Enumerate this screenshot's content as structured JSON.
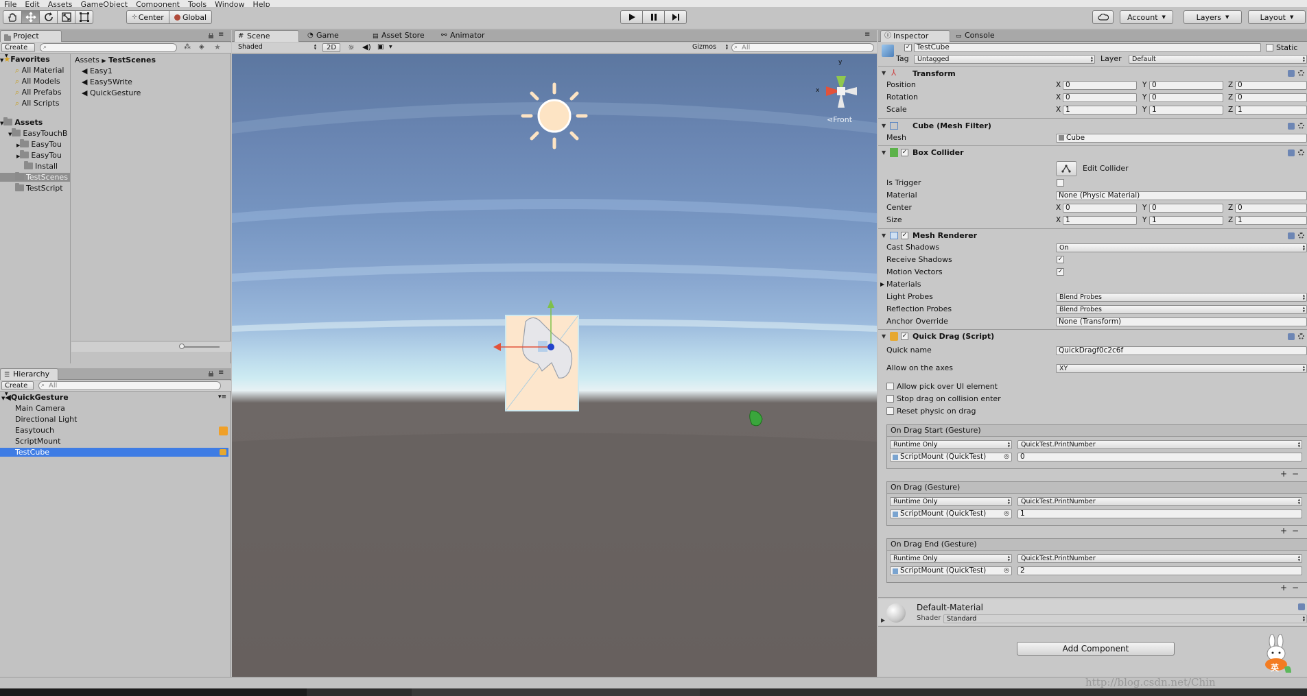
{
  "menu": [
    "File",
    "Edit",
    "Assets",
    "GameObject",
    "Component",
    "Tools",
    "Window",
    "Help"
  ],
  "toolbar": {
    "pivot_label": "Center",
    "space_label": "Global",
    "account_label": "Account",
    "layers_label": "Layers",
    "layout_label": "Layout"
  },
  "project": {
    "tab_label": "Project",
    "create_label": "Create",
    "favorites_label": "Favorites",
    "favorites": [
      "All Material",
      "All Models",
      "All Prefabs",
      "All Scripts"
    ],
    "assets_label": "Assets",
    "tree": [
      "EasyTouchB",
      "EasyTou",
      "EasyTou",
      "Install",
      "TestScenes",
      "TestScript"
    ],
    "breadcrumb_root": "Assets",
    "breadcrumb_current": "TestScenes",
    "files": [
      "Easy1",
      "Easy5Write",
      "QuickGesture"
    ]
  },
  "hierarchy": {
    "tab_label": "Hierarchy",
    "create_label": "Create",
    "search_placeholder": "All",
    "scene_name": "QuickGesture",
    "items": [
      "Main Camera",
      "Directional Light",
      "Easytouch",
      "ScriptMount",
      "TestCube"
    ],
    "selected": "TestCube"
  },
  "scene": {
    "tabs": [
      "Scene",
      "Game",
      "Asset Store",
      "Animator"
    ],
    "shading_mode": "Shaded",
    "mode_2d": "2D",
    "gizmos_label": "Gizmos",
    "search_placeholder": "All",
    "view_label": "Front",
    "axis_y": "y",
    "axis_x": "x"
  },
  "inspector": {
    "tabs": [
      "Inspector",
      "Console"
    ],
    "object_name": "TestCube",
    "static_label": "Static",
    "tag_label": "Tag",
    "tag_value": "Untagged",
    "layer_label": "Layer",
    "layer_value": "Default",
    "transform": {
      "title": "Transform",
      "position_label": "Position",
      "rotation_label": "Rotation",
      "scale_label": "Scale",
      "position": [
        "0",
        "0",
        "0"
      ],
      "rotation": [
        "0",
        "0",
        "0"
      ],
      "scale": [
        "1",
        "1",
        "1"
      ]
    },
    "axis_labels": [
      "X",
      "Y",
      "Z"
    ],
    "mesh_filter": {
      "title": "Cube (Mesh Filter)",
      "mesh_label": "Mesh",
      "mesh_value": "Cube"
    },
    "box_collider": {
      "title": "Box Collider",
      "edit_label": "Edit Collider",
      "is_trigger_label": "Is Trigger",
      "material_label": "Material",
      "material_value": "None (Physic Material)",
      "center_label": "Center",
      "center": [
        "0",
        "0",
        "0"
      ],
      "size_label": "Size",
      "size": [
        "1",
        "1",
        "1"
      ]
    },
    "mesh_renderer": {
      "title": "Mesh Renderer",
      "cast_shadows_label": "Cast Shadows",
      "cast_shadows_value": "On",
      "receive_shadows_label": "Receive Shadows",
      "motion_vectors_label": "Motion Vectors",
      "materials_label": "Materials",
      "light_probes_label": "Light Probes",
      "light_probes_value": "Blend Probes",
      "reflection_probes_label": "Reflection Probes",
      "reflection_probes_value": "Blend Probes",
      "anchor_override_label": "Anchor Override",
      "anchor_override_value": "None (Transform)"
    },
    "quick_drag": {
      "title": "Quick Drag (Script)",
      "quick_name_label": "Quick name",
      "quick_name_value": "QuickDragf0c2c6f",
      "axes_label": "Allow on the axes",
      "axes_value": "XY",
      "allow_pick_label": "Allow pick over UI element",
      "stop_drag_label": "Stop drag on collision enter",
      "reset_physic_label": "Reset physic on drag",
      "events": [
        {
          "title": "On Drag Start (Gesture)",
          "runtime": "Runtime Only",
          "function": "QuickTest.PrintNumber",
          "target": "ScriptMount (QuickTest)",
          "arg": "0"
        },
        {
          "title": "On Drag (Gesture)",
          "runtime": "Runtime Only",
          "function": "QuickTest.PrintNumber",
          "target": "ScriptMount (QuickTest)",
          "arg": "1"
        },
        {
          "title": "On Drag End (Gesture)",
          "runtime": "Runtime Only",
          "function": "QuickTest.PrintNumber",
          "target": "ScriptMount (QuickTest)",
          "arg": "2"
        }
      ]
    },
    "material": {
      "name": "Default-Material",
      "shader_label": "Shader",
      "shader_value": "Standard"
    },
    "add_component_label": "Add Component"
  },
  "watermark": "http://blog.csdn.net/Chin",
  "ime_badge": "英"
}
